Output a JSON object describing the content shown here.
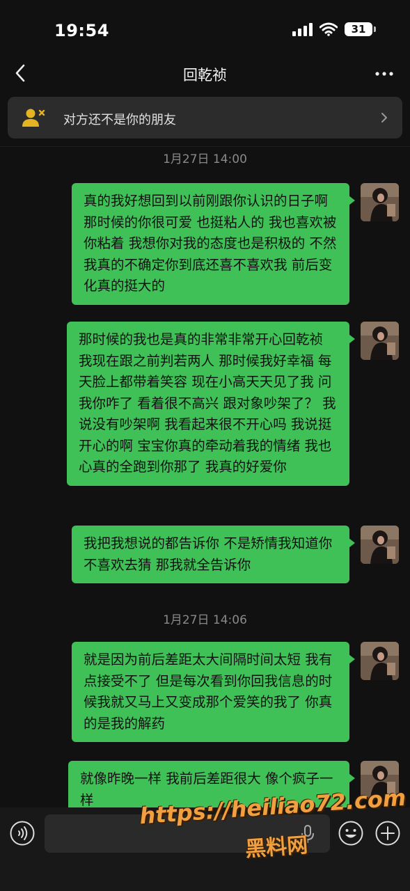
{
  "status_bar": {
    "time": "19:54",
    "battery": "31"
  },
  "nav": {
    "title": "回乾祯"
  },
  "banner": {
    "text": "对方还不是你的朋友"
  },
  "timestamps": [
    "1月27日 14:00",
    "1月27日 14:06"
  ],
  "messages": [
    {
      "text": "真的我好想回到以前刚跟你认识的日子啊 那时候的你很可爱 也挺粘人的 我也喜欢被你粘着 我想你对我的态度也是积极的 不然我真的不确定你到底还喜不喜欢我 前后变化真的挺大的"
    },
    {
      "text": "那时候的我也是真的非常非常开心回乾祯 我现在跟之前判若两人 那时候我好幸福 每天脸上都带着笑容 现在小高天天见了我 问我你咋了 看着很不高兴 跟对象吵架了？ 我说没有吵架啊 我看起来很不开心吗 我说挺开心的啊 宝宝你真的牵动着我的情绪 我也心真的全跑到你那了 我真的好爱你"
    },
    {
      "text": "我把我想说的都告诉你 不是矫情我知道你不喜欢去猜 那我就全告诉你"
    },
    {
      "text": "就是因为前后差距太大间隔时间太短 我有点接受不了 但是每次看到你回我信息的时候我就又马上又变成那个爱笑的我了 你真的是我的解药"
    },
    {
      "text": "就像昨晚一样 我前后差距很大 像个疯子一样"
    }
  ],
  "input": {
    "value": ""
  },
  "watermark": {
    "url": "https://heiliao72.com",
    "name": "黑料网"
  },
  "colors": {
    "background": "#111111",
    "bubble": "#3fc158",
    "banner": "#2c2c2c",
    "watermark": "#f0a040"
  }
}
